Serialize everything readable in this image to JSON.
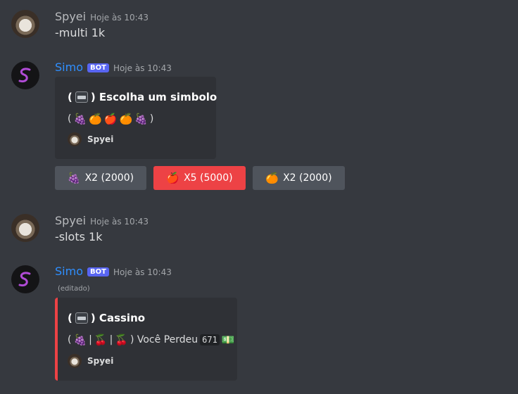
{
  "messages": [
    {
      "username": "Spyei",
      "timestamp": "Hoje às 10:43",
      "content": "-multi 1k"
    },
    {
      "username": "Simo",
      "bot_tag": "BOT",
      "timestamp": "Hoje às 10:43",
      "embed": {
        "title_open": "(",
        "title_close": ") Escolha um simbolo",
        "desc_open": "(",
        "desc_close": ")",
        "footer": "Spyei",
        "symbols": [
          "grapes-icon",
          "orange-icon",
          "apple-icon",
          "orange-icon",
          "grapes-icon"
        ]
      },
      "buttons": [
        {
          "label": "X2 (2000)",
          "icon": "grapes-icon",
          "style": "grey"
        },
        {
          "label": "X5 (5000)",
          "icon": "apple-icon",
          "style": "red"
        },
        {
          "label": "X2 (2000)",
          "icon": "orange-icon",
          "style": "grey"
        }
      ]
    },
    {
      "username": "Spyei",
      "timestamp": "Hoje às 10:43",
      "content": "-slots 1k"
    },
    {
      "username": "Simo",
      "bot_tag": "BOT",
      "timestamp": "Hoje às 10:43",
      "edited": "(editado)",
      "embed": {
        "title_open": "(",
        "title_close": ") Cassino",
        "desc_open": "(",
        "sep1": "|",
        "sep2": "|",
        "desc_mid": ") Você Perdeu",
        "amount": "671",
        "footer": "Spyei",
        "accent": "#ed4245"
      }
    }
  ],
  "colors": {
    "background": "#36393f",
    "bot_name": "#2f8fff",
    "bot_tag": "#5865f2",
    "danger": "#ed4245",
    "button_grey": "#4f545c"
  }
}
